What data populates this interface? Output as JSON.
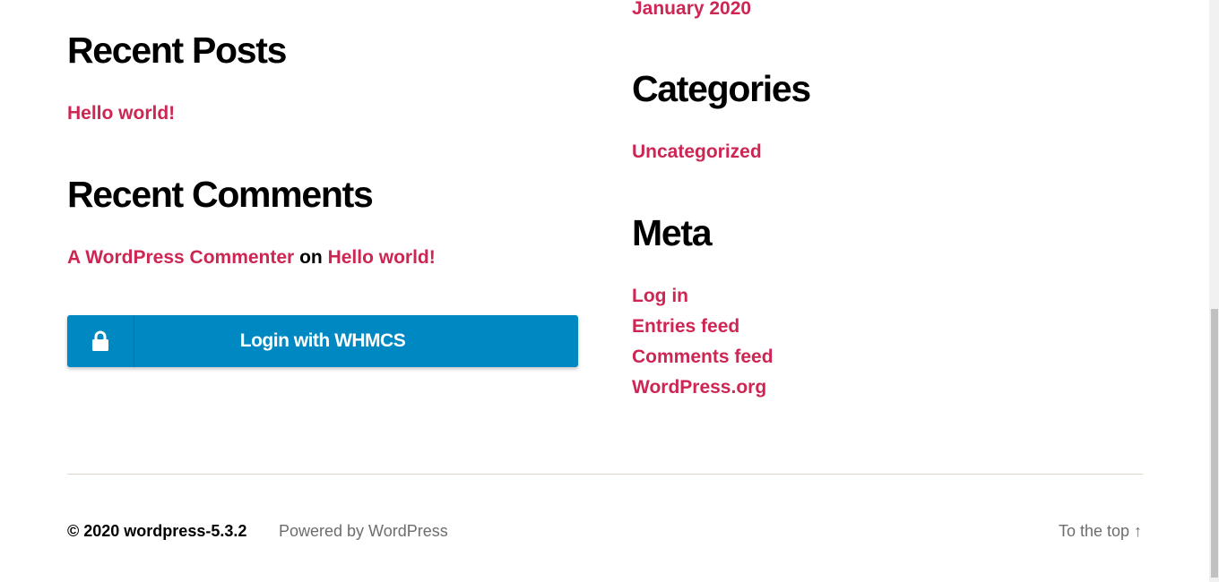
{
  "archives": {
    "last_item": "January 2020"
  },
  "recent_posts": {
    "title": "Recent Posts",
    "items": [
      "Hello world!"
    ]
  },
  "recent_comments": {
    "title": "Recent Comments",
    "author": "A WordPress Commenter",
    "on": "on",
    "post": "Hello world!"
  },
  "whmcs": {
    "label": "Login with WHMCS",
    "icon": "lock-icon",
    "color": "#0088c2"
  },
  "categories": {
    "title": "Categories",
    "items": [
      "Uncategorized"
    ]
  },
  "meta": {
    "title": "Meta",
    "items": [
      "Log in",
      "Entries feed",
      "Comments feed",
      "WordPress.org"
    ]
  },
  "footer": {
    "copyright": "© 2020 wordpress-5.3.2",
    "powered": "Powered by WordPress",
    "to_top": "To the top ↑"
  },
  "colors": {
    "link": "#cd2653",
    "heading": "#000000",
    "muted": "#6d6d6d"
  }
}
